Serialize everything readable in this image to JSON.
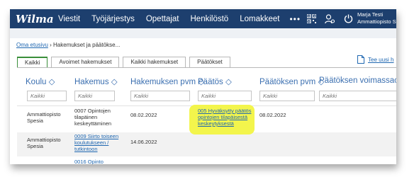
{
  "app": {
    "logo": "Wilma"
  },
  "nav": [
    "Viestit",
    "Työjärjestys",
    "Opettajat",
    "Henkilöstö",
    "Lomakkeet"
  ],
  "nav_more": "•••",
  "user": {
    "name": "Marja Testi",
    "org": "Ammattiopisto S"
  },
  "breadcrumb": {
    "home": "Oma etusivu",
    "sep": " › ",
    "current": "Hakemukset ja päätökse..."
  },
  "tabs": [
    "Kaikki",
    "Avoimet hakemukset",
    "Kaikki hakemukset",
    "Päätökset"
  ],
  "new_link": "Tee uusi h",
  "columns": [
    "Koulu ◇",
    "Hakemus ◇",
    "Hakemuksen pvm ◇",
    "Päätös ◇",
    "Päätöksen pvm ◇",
    "Päätöksen voimassaolo"
  ],
  "filter_placeholder": "Kaikki",
  "rows": [
    {
      "school": [
        "Ammattiopisto",
        "Spesia"
      ],
      "application": [
        "0007 Opintojen",
        "tilapäinen",
        "keskeyttäminen"
      ],
      "app_date": "08.02.2022",
      "decision": [
        "005 Hyväksytty päätös",
        "opintojen tilapäisestä",
        "keskeytyksestä"
      ],
      "decision_date": "08.02.2022"
    },
    {
      "school": [
        "Ammattiopisto",
        "Spesia"
      ],
      "application": [
        "0009 Siirto toiseen",
        "koulutukseen /",
        "tutkintoon"
      ],
      "app_date": "14.06.2022"
    },
    {
      "application": [
        "0016 Opinto"
      ]
    }
  ],
  "colors": {
    "topbar": "#1d3f6e",
    "link": "#1f67b1",
    "highlight": "#f3f54c",
    "active_tab": "#3a8f3a"
  }
}
